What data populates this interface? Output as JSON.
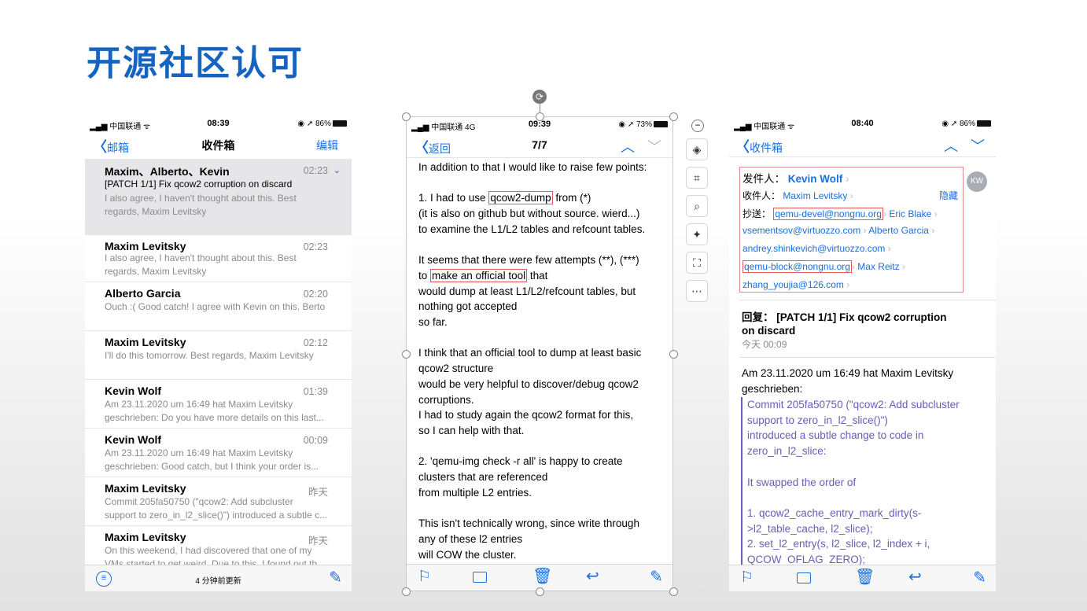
{
  "page_title": "开源社区认可",
  "left_phone": {
    "status": {
      "carrier": "中国联通",
      "time": "08:39",
      "battery": "86%"
    },
    "nav": {
      "back": "邮箱",
      "title": "收件箱",
      "edit": "编辑"
    },
    "mails": [
      {
        "from": "Maxim、Alberto、Kevin",
        "time": "02:23",
        "subject": "[PATCH 1/1] Fix qcow2 corruption on discard",
        "preview1": "I also agree, I haven't thought about this. Best",
        "preview2": "regards, Maxim Levitsky"
      },
      {
        "from": "Maxim Levitsky",
        "time": "02:23",
        "preview1": "I also agree, I haven't thought about this. Best",
        "preview2": "regards, Maxim Levitsky"
      },
      {
        "from": "Alberto Garcia",
        "time": "02:20",
        "preview1": "Ouch :( Good catch! I agree with Kevin on this. Berto",
        "preview2": ""
      },
      {
        "from": "Maxim Levitsky",
        "time": "02:12",
        "preview1": "I'll do this tomorrow. Best regards, Maxim Levitsky",
        "preview2": ""
      },
      {
        "from": "Kevin Wolf",
        "time": "01:39",
        "preview1": "Am 23.11.2020 um 16:49 hat Maxim Levitsky",
        "preview2": "geschrieben: Do you have more details on this last..."
      },
      {
        "from": "Kevin Wolf",
        "time": "00:09",
        "preview1": "Am 23.11.2020 um 16:49 hat Maxim Levitsky",
        "preview2": "geschrieben: Good catch, but I think your order is..."
      },
      {
        "from": "Maxim Levitsky",
        "time": "昨天",
        "preview1": "Commit 205fa50750 (\"qcow2: Add subcluster",
        "preview2": "support to zero_in_l2_slice()\") introduced a subtle c..."
      },
      {
        "from": "Maxim Levitsky",
        "time": "昨天",
        "preview1": "On this weekend, I had discovered that one of my",
        "preview2": "VMs started to get weird. Due to this, I found out th..."
      }
    ],
    "updated": "4 分钟前更新"
  },
  "mid_phone": {
    "status": {
      "carrier": "中国联通",
      "network": "4G",
      "time": "09:39",
      "battery": "73%"
    },
    "nav": {
      "back": "返回",
      "title": "7/7"
    },
    "lines": [
      {
        "t": "In addition to that I would like to raise few points:"
      },
      {
        "t": ""
      },
      {
        "pre": "1. I had to use ",
        "hl": "qcow2-dump",
        "post": " from (*)"
      },
      {
        "t": "(it is also on github but without source. wierd...)"
      },
      {
        "t": "to examine the L1/L2 tables and refcount tables."
      },
      {
        "t": ""
      },
      {
        "t": "It seems that there were few attempts (**), (***)"
      },
      {
        "pre": "to ",
        "hl": "make an official tool",
        "post": " that"
      },
      {
        "t": "would dump at least L1/L2/refcount tables, but"
      },
      {
        "t": "nothing got accepted"
      },
      {
        "t": "so far."
      },
      {
        "t": ""
      },
      {
        "t": "I think that an official tool to dump at least basic"
      },
      {
        "t": "qcow2 structure"
      },
      {
        "t": "would be very helpful to discover/debug qcow2"
      },
      {
        "t": "corruptions."
      },
      {
        "t": "I had to study again the qcow2 format for this,"
      },
      {
        "t": "so I can help with that."
      },
      {
        "t": ""
      },
      {
        "t": "2. 'qemu-img check -r all' is happy to create"
      },
      {
        "t": "clusters that are referenced"
      },
      {
        "t": "from multiple L2 entries."
      },
      {
        "t": ""
      },
      {
        "t": "This isn't technically wrong, since write through"
      },
      {
        "t": "any of these l2 entries"
      },
      {
        "t": "will COW the cluster."
      }
    ]
  },
  "right_phone": {
    "status": {
      "carrier": "中国联通",
      "time": "08:40",
      "battery": "86%"
    },
    "nav": {
      "back": "收件箱"
    },
    "avatar": "KW",
    "from_label": "发件人：",
    "from": "Kevin Wolf",
    "to_label": "收件人：",
    "to": "Maxim Levitsky",
    "hide": "隐藏",
    "cc_label": "抄送：",
    "cc1": "qemu-devel@nongnu.org",
    "cc2": "Eric Blake",
    "cc3": "vsementsov@virtuozzo.com",
    "cc4": "Alberto Garcia",
    "cc5": "andrey.shinkevich@virtuozzo.com",
    "cc6": "qemu-block@nongnu.org",
    "cc7": "Max Reitz",
    "cc8": "zhang_youjia@126.com",
    "subject1": "回复： [PATCH 1/1] Fix qcow2 corruption",
    "subject2": "on discard",
    "date": "今天 00:09",
    "intro1": "Am 23.11.2020 um 16:49 hat Maxim Levitsky",
    "intro2": "geschrieben:",
    "quote": [
      "Commit 205fa50750 (\"qcow2: Add subcluster",
      "support to zero_in_l2_slice()\")",
      "introduced a subtle change to code in",
      "zero_in_l2_slice:",
      "",
      "It swapped the order of",
      "",
      "1. qcow2_cache_entry_mark_dirty(s-",
      ">l2_table_cache, l2_slice);",
      "2. set_l2_entry(s, l2_slice, l2_index + i,",
      "QCOW_OFLAG_ZERO);"
    ]
  }
}
